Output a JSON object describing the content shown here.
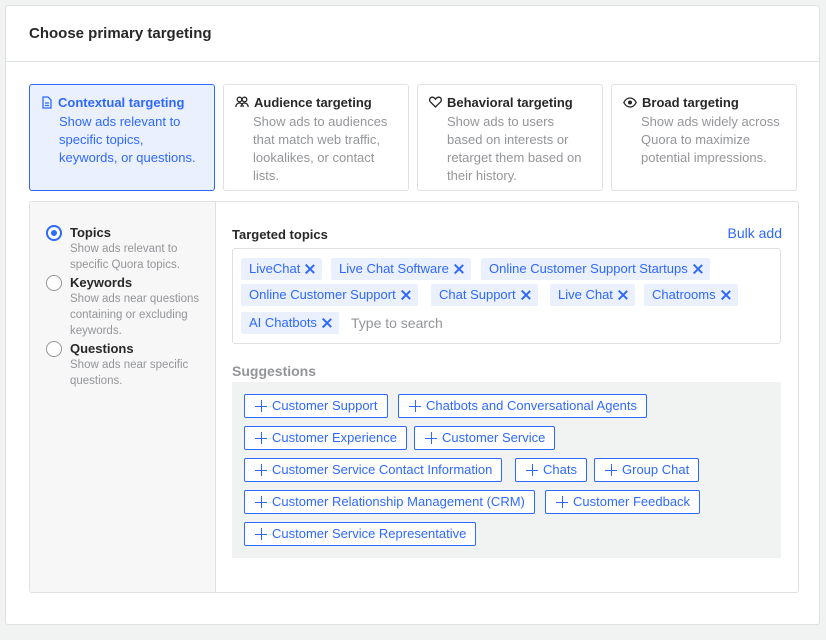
{
  "header": {
    "title": "Choose primary targeting"
  },
  "cards": [
    {
      "title": "Contextual targeting",
      "icon": "document-icon",
      "desc": "Show ads relevant to specific topics, keywords, or questions.",
      "selected": true
    },
    {
      "title": "Audience targeting",
      "icon": "people-icon",
      "desc": "Show ads to audiences that match web traffic, lookalikes, or contact lists.",
      "selected": false
    },
    {
      "title": "Behavioral targeting",
      "icon": "heart-icon",
      "desc": "Show ads to users based on interests or retarget them based on their history.",
      "selected": false
    },
    {
      "title": "Broad targeting",
      "icon": "eye-icon",
      "desc": "Show ads widely across Quora to maximize potential impressions.",
      "selected": false
    }
  ],
  "options": [
    {
      "title": "Topics",
      "desc": "Show ads relevant to specific Quora topics.",
      "selected": true
    },
    {
      "title": "Keywords",
      "desc": "Show ads near questions containing or excluding keywords.",
      "selected": false
    },
    {
      "title": "Questions",
      "desc": "Show ads near specific questions.",
      "selected": false
    }
  ],
  "targeted": {
    "label": "Targeted topics",
    "bulk_add": "Bulk add",
    "search_placeholder": "Type to search",
    "tags": [
      "LiveChat",
      "Live Chat Software",
      "Online Customer Support Startups",
      "Online Customer Support",
      "Chat Support",
      "Live Chat",
      "Chatrooms",
      "AI Chatbots"
    ]
  },
  "suggestions": {
    "label": "Suggestions",
    "items": [
      "Customer Support",
      "Chatbots and Conversational Agents",
      "Customer Experience",
      "Customer Service",
      "Customer Service Contact Information",
      "Chats",
      "Group Chat",
      "Customer Relationship Management (CRM)",
      "Customer Feedback",
      "Customer Service Representative"
    ]
  },
  "colors": {
    "accent": "#2e69ff",
    "selected_bg": "#ebf0ff",
    "muted": "#939598",
    "border": "#dee0e1"
  }
}
